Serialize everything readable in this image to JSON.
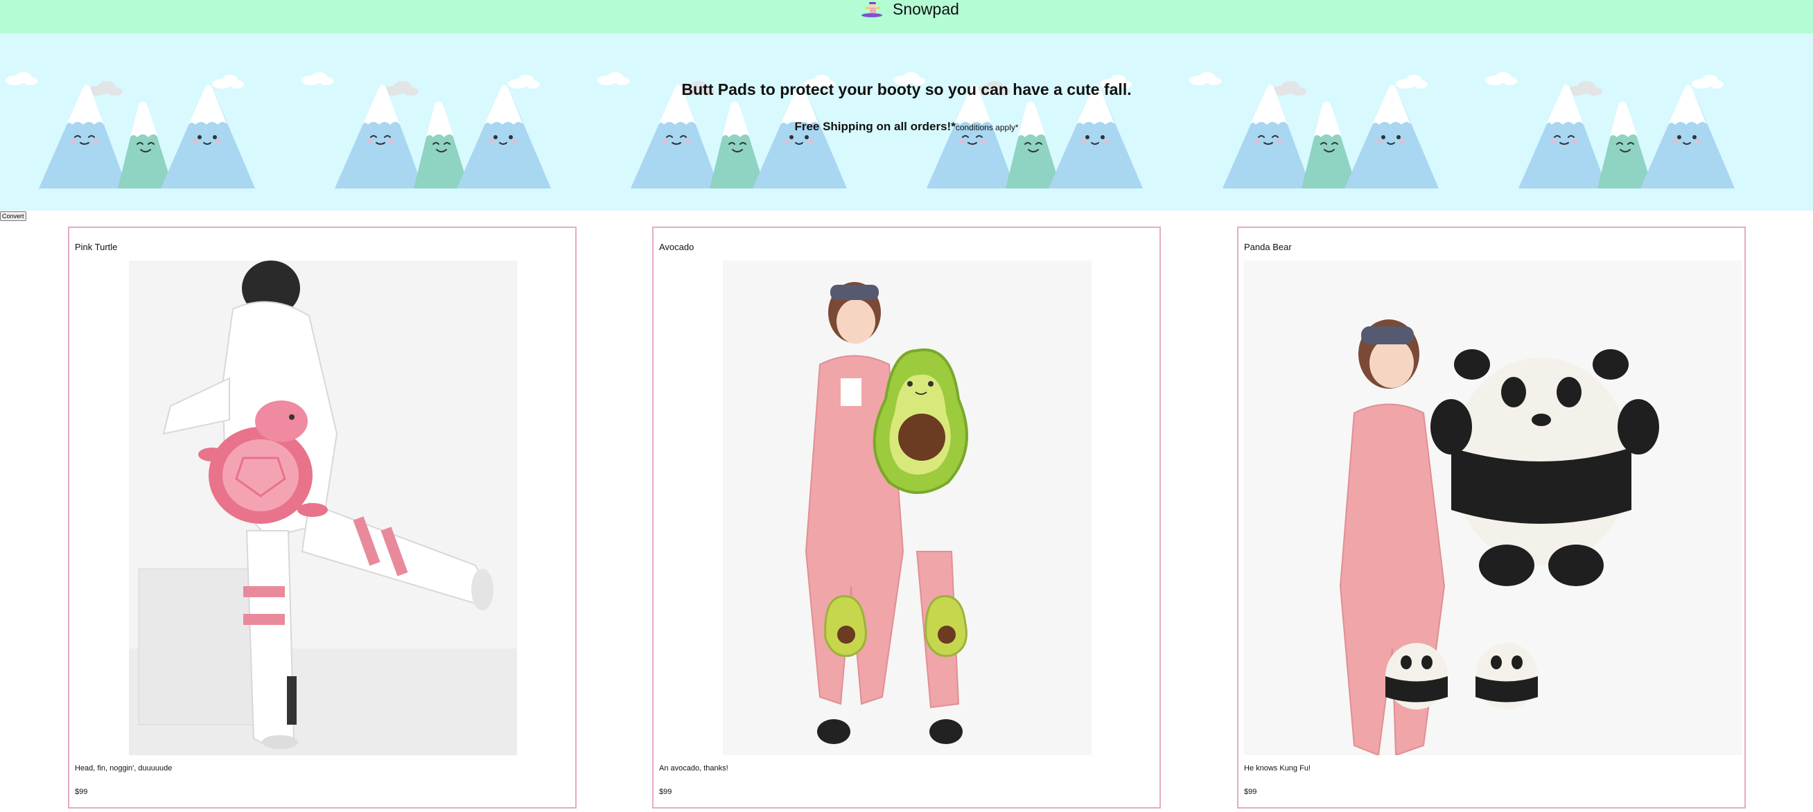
{
  "header": {
    "brand_name": "Snowpad",
    "logo_icon": "snowboarder-logo-icon",
    "background": "#b3fcd4"
  },
  "banner": {
    "tagline": "Butt Pads to protect your booty so you can have a cute fall.",
    "shipping_main": "Free Shipping on all orders!*",
    "shipping_conditions": "conditions apply*",
    "background": "#d8f9fd",
    "illustration": "smiling-snow-mountains-icon"
  },
  "convert_button": {
    "label": "Convert"
  },
  "products": [
    {
      "name": "Pink Turtle",
      "description": "Head, fin, noggin', duuuuude",
      "price": "$99",
      "image_icon": "pink-turtle-pad-photo"
    },
    {
      "name": "Avocado",
      "description": "An avocado, thanks!",
      "price": "$99",
      "image_icon": "avocado-pad-photo"
    },
    {
      "name": "Panda Bear",
      "description": "He knows Kung Fu!",
      "price": "$99",
      "image_icon": "panda-pad-photo"
    }
  ],
  "colors": {
    "card_border": "#e6a9c8",
    "mountain_blue": "#a9d6f1",
    "mountain_teal": "#8fd3c2"
  }
}
